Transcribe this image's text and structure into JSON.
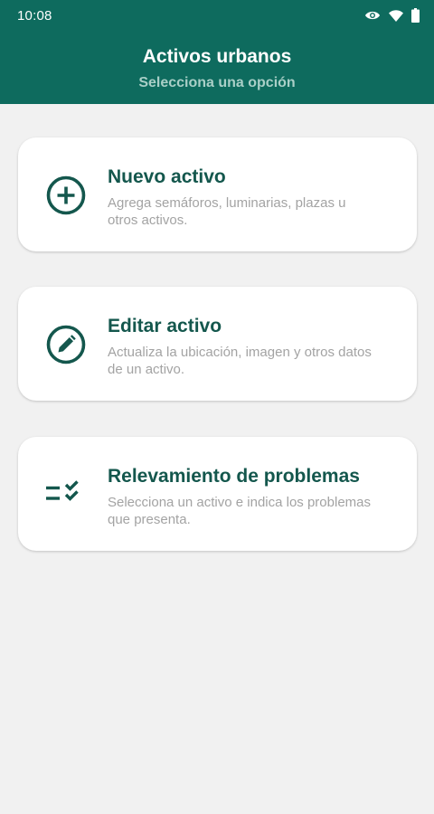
{
  "status_bar": {
    "time": "10:08",
    "icons": [
      "eye-icon",
      "wifi-icon",
      "battery-icon"
    ]
  },
  "header": {
    "title": "Activos urbanos",
    "subtitle": "Selecciona una opción"
  },
  "colors": {
    "primary": "#0e6b5e",
    "icon": "#14574d",
    "subtitle": "#a9cfc7",
    "background": "#f1f1f1",
    "description": "#a3a3a3"
  },
  "options": [
    {
      "icon": "add-circle-icon",
      "title": "Nuevo activo",
      "description": "Agrega semáforos, luminarias, plazas u otros activos."
    },
    {
      "icon": "edit-circle-icon",
      "title": "Editar activo",
      "description": "Actualiza la ubicación, imagen y otros datos de un activo."
    },
    {
      "icon": "checklist-icon",
      "title": "Relevamiento de problemas",
      "description": "Selecciona un activo e indica los problemas que presenta."
    }
  ]
}
